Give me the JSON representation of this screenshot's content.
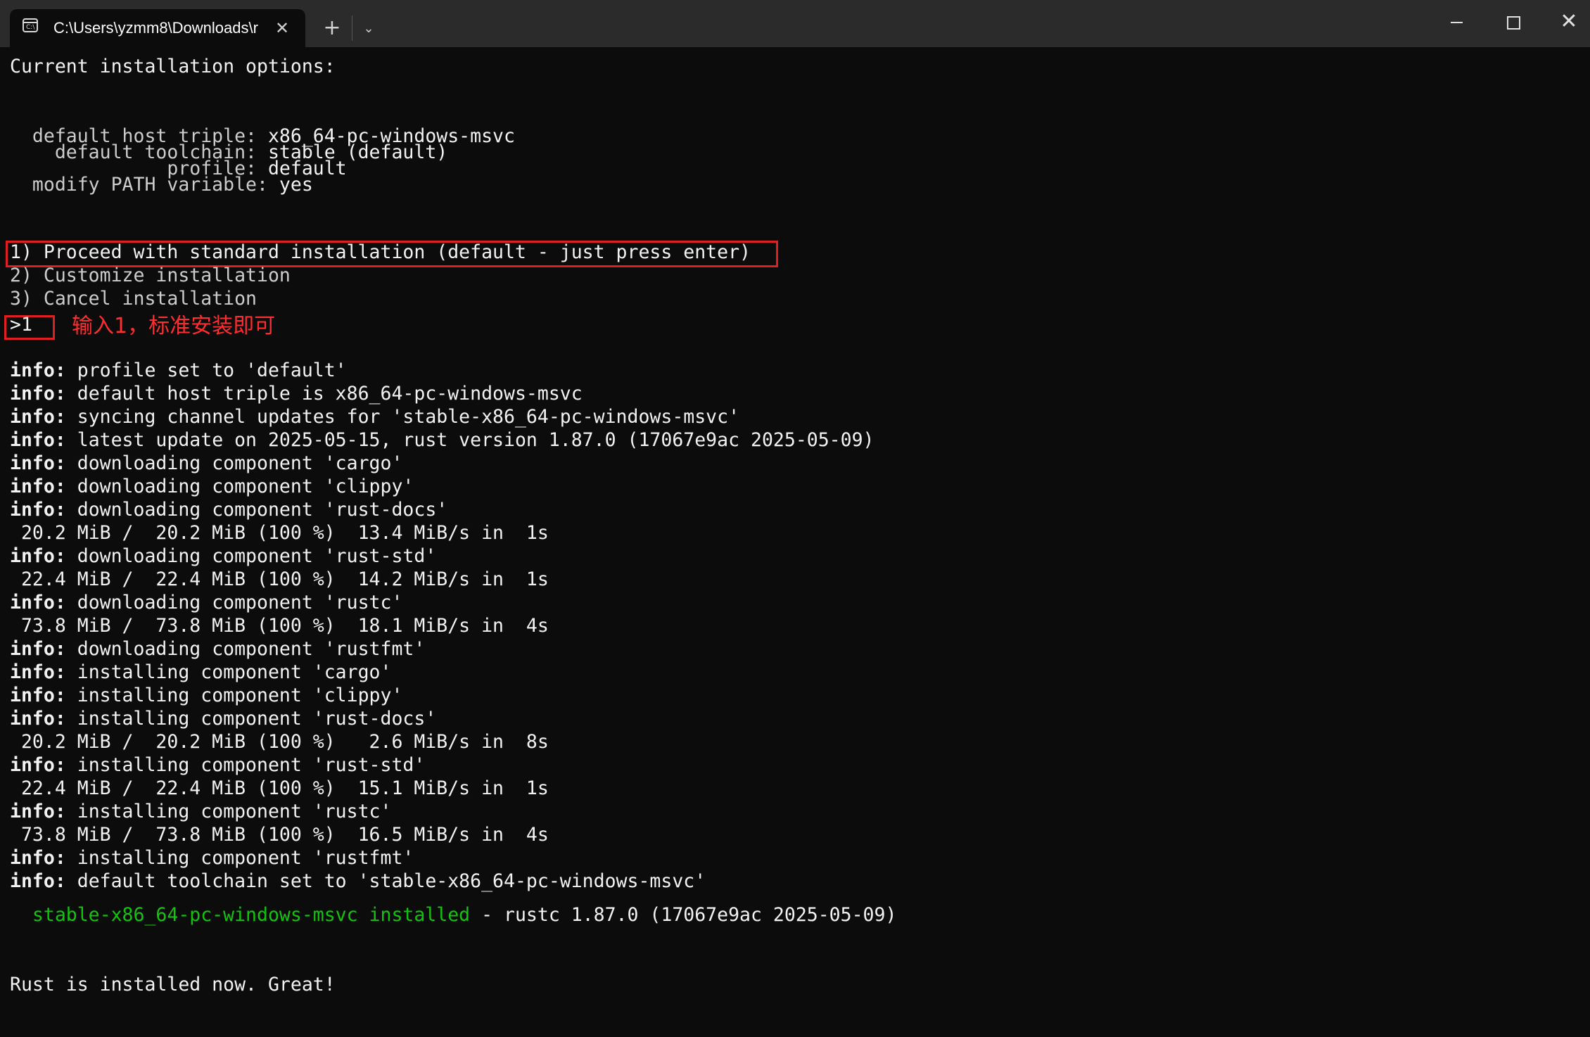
{
  "window": {
    "tab_title": "C:\\Users\\yzmm8\\Downloads\\r",
    "tab_icon": "terminal-icon",
    "tab_close_glyph": "✕",
    "new_tab_glyph": "+",
    "dropdown_glyph": "⌄",
    "close_glyph": "✕"
  },
  "console": {
    "header": "Current installation options:",
    "options": [
      {
        "label": "  default host triple: ",
        "value": "x86_64-pc-windows-msvc"
      },
      {
        "label": "    default toolchain: ",
        "value": "stable (default)"
      },
      {
        "label": "              profile: ",
        "value": "default"
      },
      {
        "label": "  modify PATH variable: ",
        "value": "yes"
      }
    ],
    "menu": [
      "1) Proceed with standard installation (default - just press enter)",
      "2) Customize installation",
      "3) Cancel installation"
    ],
    "input": ">1",
    "annotation": "输入1，标准安装即可",
    "log": [
      {
        "prefix": "info:",
        "text": " profile set to 'default'"
      },
      {
        "prefix": "info:",
        "text": " default host triple is x86_64-pc-windows-msvc"
      },
      {
        "prefix": "info:",
        "text": " syncing channel updates for 'stable-x86_64-pc-windows-msvc'"
      },
      {
        "prefix": "info:",
        "text": " latest update on 2025-05-15, rust version 1.87.0 (17067e9ac 2025-05-09)"
      },
      {
        "prefix": "info:",
        "text": " downloading component 'cargo'"
      },
      {
        "prefix": "info:",
        "text": " downloading component 'clippy'"
      },
      {
        "prefix": "info:",
        "text": " downloading component 'rust-docs'"
      },
      {
        "prefix": "",
        "text": " 20.2 MiB /  20.2 MiB (100 %)  13.4 MiB/s in  1s"
      },
      {
        "prefix": "info:",
        "text": " downloading component 'rust-std'"
      },
      {
        "prefix": "",
        "text": " 22.4 MiB /  22.4 MiB (100 %)  14.2 MiB/s in  1s"
      },
      {
        "prefix": "info:",
        "text": " downloading component 'rustc'"
      },
      {
        "prefix": "",
        "text": " 73.8 MiB /  73.8 MiB (100 %)  18.1 MiB/s in  4s"
      },
      {
        "prefix": "info:",
        "text": " downloading component 'rustfmt'"
      },
      {
        "prefix": "info:",
        "text": " installing component 'cargo'"
      },
      {
        "prefix": "info:",
        "text": " installing component 'clippy'"
      },
      {
        "prefix": "info:",
        "text": " installing component 'rust-docs'"
      },
      {
        "prefix": "",
        "text": " 20.2 MiB /  20.2 MiB (100 %)   2.6 MiB/s in  8s"
      },
      {
        "prefix": "info:",
        "text": " installing component 'rust-std'"
      },
      {
        "prefix": "",
        "text": " 22.4 MiB /  22.4 MiB (100 %)  15.1 MiB/s in  1s"
      },
      {
        "prefix": "info:",
        "text": " installing component 'rustc'"
      },
      {
        "prefix": "",
        "text": " 73.8 MiB /  73.8 MiB (100 %)  16.5 MiB/s in  4s"
      },
      {
        "prefix": "info:",
        "text": " installing component 'rustfmt'"
      },
      {
        "prefix": "info:",
        "text": " default toolchain set to 'stable-x86_64-pc-windows-msvc'"
      }
    ],
    "installed_green": "  stable-x86_64-pc-windows-msvc installed",
    "installed_rest": " - rustc 1.87.0 (17067e9ac 2025-05-09)",
    "final": "Rust is installed now. Great!"
  },
  "colors": {
    "background": "#0c0c0c",
    "text": "#cccccc",
    "highlight_box": "#e02020",
    "annotation": "#ff2d2d",
    "success": "#13c30e"
  }
}
